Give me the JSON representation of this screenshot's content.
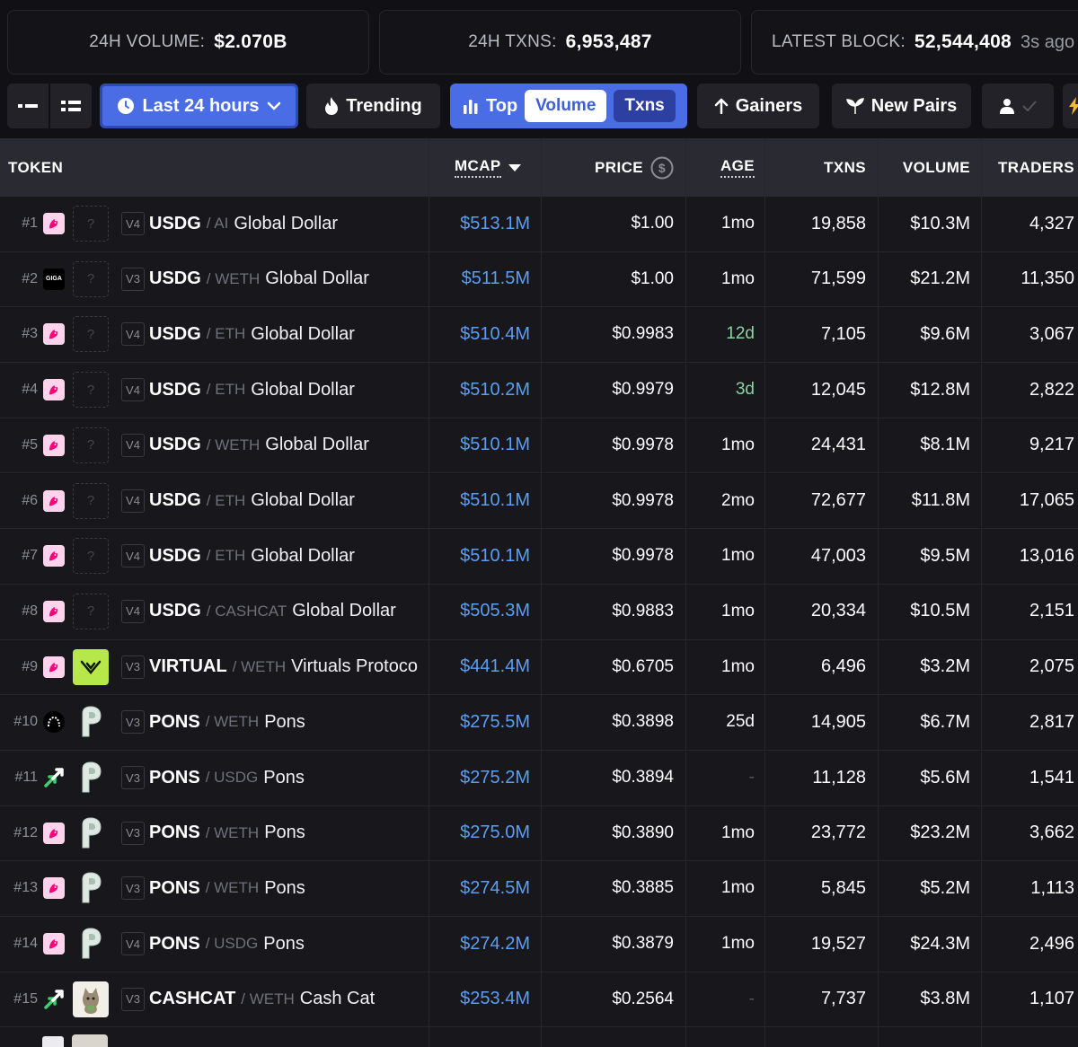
{
  "stats": {
    "volume_label": "24H VOLUME:",
    "volume_value": "$2.070B",
    "txns_label": "24H TXNS:",
    "txns_value": "6,953,487",
    "block_label": "LATEST BLOCK:",
    "block_value": "52,544,408",
    "block_ago": "3s ago"
  },
  "toolbar": {
    "time_label": "Last 24 hours",
    "trending_label": "Trending",
    "top_label": "Top",
    "volume_label": "Volume",
    "txns_label": "Txns",
    "gainers_label": "Gainers",
    "new_pairs_label": "New Pairs"
  },
  "columns": {
    "token": "TOKEN",
    "mcap": "MCAP",
    "price": "PRICE",
    "age": "AGE",
    "txns": "TXNS",
    "volume": "VOLUME",
    "traders": "TRADERS"
  },
  "colors": {
    "accent": "#4a6de6",
    "mcap_text": "#5a9ef5",
    "row_bg": "#17171c",
    "header_bg": "#2a2a32"
  },
  "rows": [
    {
      "rank": "#1",
      "dex": "uniswap-icon",
      "token_icon": "unknown-token-icon",
      "ver": "V4",
      "symbol": "USDG",
      "quote": "/ AI",
      "name": "Global Dollar",
      "mcap": "$513.1M",
      "price": "$1.00",
      "age": "1mo",
      "txns": "19,858",
      "volume": "$10.3M",
      "traders": "4,327"
    },
    {
      "rank": "#2",
      "dex": "giga-icon",
      "token_icon": "unknown-token-icon",
      "ver": "V3",
      "symbol": "USDG",
      "quote": "/ WETH",
      "name": "Global Dollar",
      "mcap": "$511.5M",
      "price": "$1.00",
      "age": "1mo",
      "txns": "71,599",
      "volume": "$21.2M",
      "traders": "11,350"
    },
    {
      "rank": "#3",
      "dex": "uniswap-icon",
      "token_icon": "unknown-token-icon",
      "ver": "V4",
      "symbol": "USDG",
      "quote": "/ ETH",
      "name": "Global Dollar",
      "mcap": "$510.4M",
      "price": "$0.9983",
      "age": "12d",
      "txns": "7,105",
      "volume": "$9.6M",
      "traders": "3,067"
    },
    {
      "rank": "#4",
      "dex": "uniswap-icon",
      "token_icon": "unknown-token-icon",
      "ver": "V4",
      "symbol": "USDG",
      "quote": "/ ETH",
      "name": "Global Dollar",
      "mcap": "$510.2M",
      "price": "$0.9979",
      "age": "3d",
      "txns": "12,045",
      "volume": "$12.8M",
      "traders": "2,822"
    },
    {
      "rank": "#5",
      "dex": "uniswap-icon",
      "token_icon": "unknown-token-icon",
      "ver": "V4",
      "symbol": "USDG",
      "quote": "/ WETH",
      "name": "Global Dollar",
      "mcap": "$510.1M",
      "price": "$0.9978",
      "age": "1mo",
      "txns": "24,431",
      "volume": "$8.1M",
      "traders": "9,217"
    },
    {
      "rank": "#6",
      "dex": "uniswap-icon",
      "token_icon": "unknown-token-icon",
      "ver": "V4",
      "symbol": "USDG",
      "quote": "/ ETH",
      "name": "Global Dollar",
      "mcap": "$510.1M",
      "price": "$0.9978",
      "age": "2mo",
      "txns": "72,677",
      "volume": "$11.8M",
      "traders": "17,065"
    },
    {
      "rank": "#7",
      "dex": "uniswap-icon",
      "token_icon": "unknown-token-icon",
      "ver": "V4",
      "symbol": "USDG",
      "quote": "/ ETH",
      "name": "Global Dollar",
      "mcap": "$510.1M",
      "price": "$0.9978",
      "age": "1mo",
      "txns": "47,003",
      "volume": "$9.5M",
      "traders": "13,016"
    },
    {
      "rank": "#8",
      "dex": "uniswap-icon",
      "token_icon": "unknown-token-icon",
      "ver": "V4",
      "symbol": "USDG",
      "quote": "/ CASHCAT",
      "name": "Global Dollar",
      "mcap": "$505.3M",
      "price": "$0.9883",
      "age": "1mo",
      "txns": "20,334",
      "volume": "$10.5M",
      "traders": "2,151"
    },
    {
      "rank": "#9",
      "dex": "uniswap-icon",
      "token_icon": "virtual-token-icon",
      "ver": "V3",
      "symbol": "VIRTUAL",
      "quote": "/ WETH",
      "name": "Virtuals Protoco",
      "mcap": "$441.4M",
      "price": "$0.6705",
      "age": "1mo",
      "txns": "6,496",
      "volume": "$3.2M",
      "traders": "2,075"
    },
    {
      "rank": "#10",
      "dex": "aerodrome-icon",
      "token_icon": "pons-token-icon",
      "ver": "V3",
      "symbol": "PONS",
      "quote": "/ WETH",
      "name": "Pons",
      "mcap": "$275.5M",
      "price": "$0.3898",
      "age": "25d",
      "txns": "14,905",
      "volume": "$6.7M",
      "traders": "2,817"
    },
    {
      "rank": "#11",
      "dex": "arrow-dex-icon",
      "token_icon": "pons-token-icon",
      "ver": "V3",
      "symbol": "PONS",
      "quote": "/ USDG",
      "name": "Pons",
      "mcap": "$275.2M",
      "price": "$0.3894",
      "age": "-",
      "txns": "11,128",
      "volume": "$5.6M",
      "traders": "1,541"
    },
    {
      "rank": "#12",
      "dex": "uniswap-icon",
      "token_icon": "pons-token-icon",
      "ver": "V3",
      "symbol": "PONS",
      "quote": "/ WETH",
      "name": "Pons",
      "mcap": "$275.0M",
      "price": "$0.3890",
      "age": "1mo",
      "txns": "23,772",
      "volume": "$23.2M",
      "traders": "3,662"
    },
    {
      "rank": "#13",
      "dex": "uniswap-icon",
      "token_icon": "pons-token-icon",
      "ver": "V3",
      "symbol": "PONS",
      "quote": "/ WETH",
      "name": "Pons",
      "mcap": "$274.5M",
      "price": "$0.3885",
      "age": "1mo",
      "txns": "5,845",
      "volume": "$5.2M",
      "traders": "1,113"
    },
    {
      "rank": "#14",
      "dex": "uniswap-icon",
      "token_icon": "pons-token-icon",
      "ver": "V4",
      "symbol": "PONS",
      "quote": "/ USDG",
      "name": "Pons",
      "mcap": "$274.2M",
      "price": "$0.3879",
      "age": "1mo",
      "txns": "19,527",
      "volume": "$24.3M",
      "traders": "2,496"
    },
    {
      "rank": "#15",
      "dex": "arrow-dex-icon",
      "token_icon": "cashcat-token-icon",
      "ver": "V3",
      "symbol": "CASHCAT",
      "quote": "/ WETH",
      "name": "Cash Cat",
      "mcap": "$253.4M",
      "price": "$0.2564",
      "age": "-",
      "txns": "7,737",
      "volume": "$3.8M",
      "traders": "1,107"
    }
  ]
}
